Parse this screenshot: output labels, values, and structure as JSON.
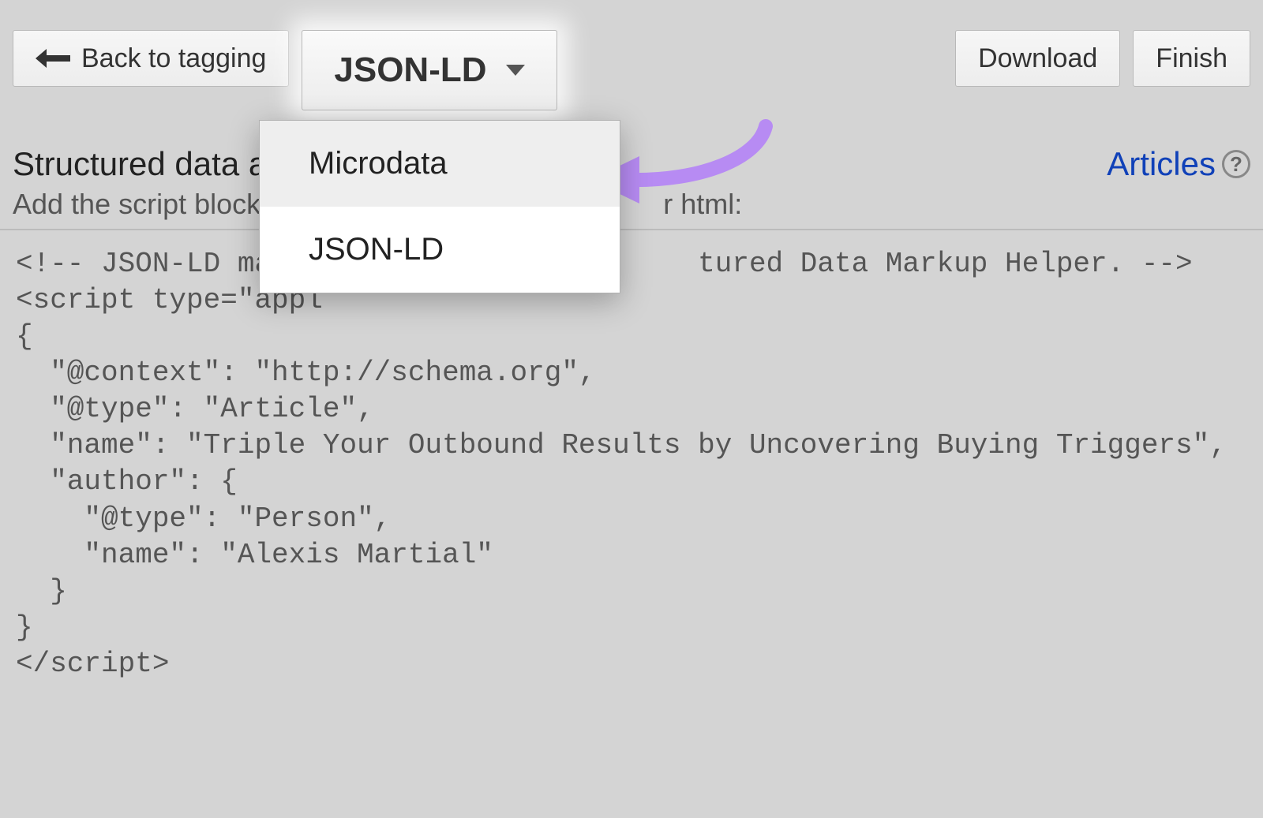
{
  "toolbar": {
    "back_label": "Back to tagging",
    "format_selected": "JSON-LD",
    "download_label": "Download",
    "finish_label": "Finish"
  },
  "dropdown": {
    "options": [
      "Microdata",
      "JSON-LD"
    ]
  },
  "header": {
    "title": "Structured data a",
    "subtitle_part1": "Add the script block b",
    "subtitle_part2": "r html:",
    "articles_link": "Articles"
  },
  "code": {
    "lines": [
      "<!-- JSON-LD marku                      tured Data Markup Helper. -->",
      "<script type=\"appl",
      "{",
      "  \"@context\": \"http://schema.org\",",
      "  \"@type\": \"Article\",",
      "  \"name\": \"Triple Your Outbound Results by Uncovering Buying Triggers\",",
      "  \"author\": {",
      "    \"@type\": \"Person\",",
      "    \"name\": \"Alexis Martial\"",
      "  }",
      "}",
      "</script>"
    ]
  }
}
